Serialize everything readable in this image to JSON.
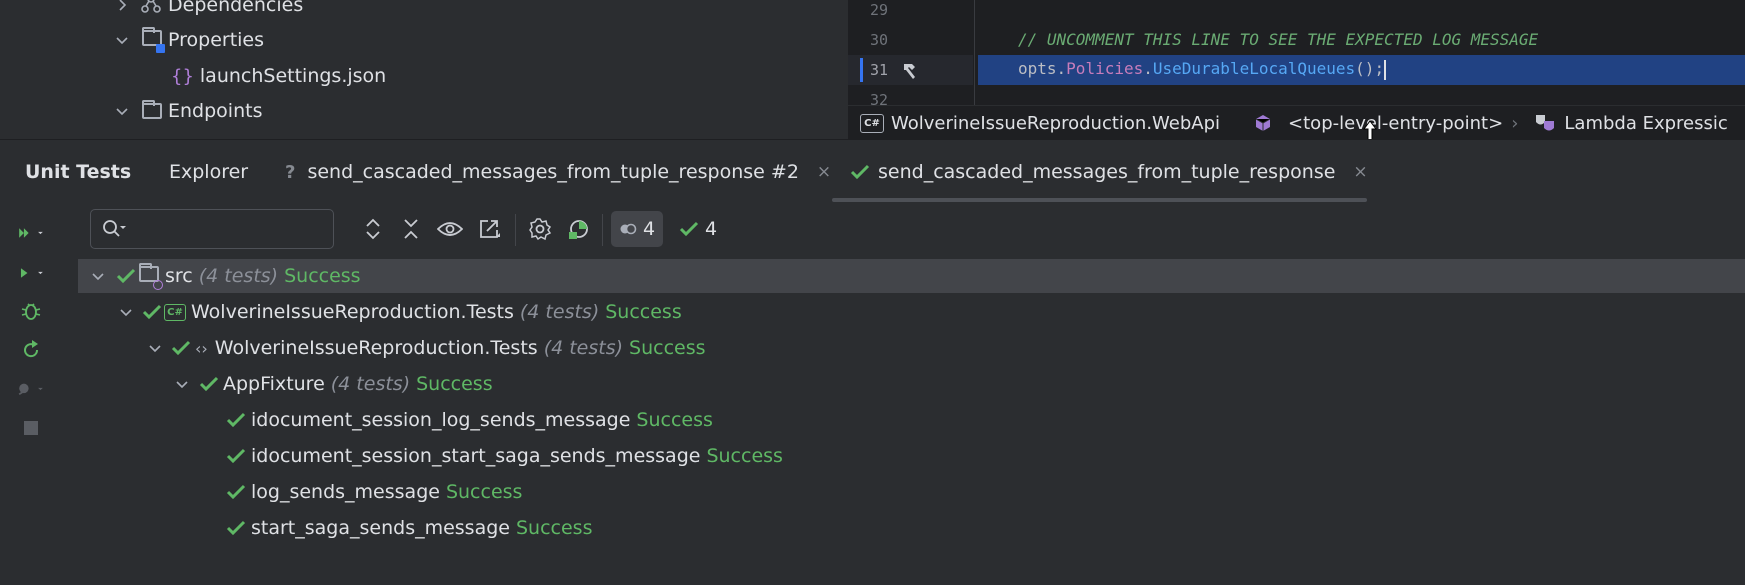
{
  "project_tree": {
    "items": [
      {
        "label": "Dependencies"
      },
      {
        "label": "Properties"
      },
      {
        "label": "launchSettings.json"
      },
      {
        "label": "Endpoints"
      }
    ]
  },
  "editor": {
    "line_numbers": [
      "29",
      "30",
      "31",
      "32"
    ],
    "comment_line": "// UNCOMMENT THIS LINE TO SEE THE EXPECTED LOG MESSAGE",
    "code_line": {
      "obj": "opts",
      "dot1": ".",
      "prop": "Policies",
      "dot2": ".",
      "method": "UseDurableLocalQueues",
      "tail": "();"
    },
    "breadcrumbs": {
      "project_badge": "C#",
      "project": "WolverineIssueReproduction.WebApi",
      "entry": "<top-level-entry-point>",
      "separator": "›",
      "lambda": "Lambda Expressic"
    }
  },
  "tool_window": {
    "title": "Unit Tests",
    "explorer_tab": "Explorer",
    "session_tab_1": "send_cascaded_messages_from_tuple_response #2",
    "session_tab_2": "send_cascaded_messages_from_tuple_response",
    "close_glyph": "×",
    "unknown_glyph": "?"
  },
  "toolbar": {
    "search_placeholder": "",
    "total_count": "4",
    "passed_count": "4"
  },
  "tests": {
    "root": {
      "label": "src",
      "count": "(4 tests)",
      "status": "Success"
    },
    "project": {
      "badge": "C#",
      "label": "WolverineIssueReproduction.Tests",
      "count": "(4 tests)",
      "status": "Success"
    },
    "namespace": {
      "label": "WolverineIssueReproduction.Tests",
      "count": "(4 tests)",
      "status": "Success",
      "glyph": "‹›"
    },
    "fixture": {
      "label": "AppFixture",
      "count": "(4 tests)",
      "status": "Success"
    },
    "cases": [
      {
        "label": "idocument_session_log_sends_message",
        "status": "Success"
      },
      {
        "label": "idocument_session_start_saga_sends_message",
        "status": "Success"
      },
      {
        "label": "log_sends_message",
        "status": "Success"
      },
      {
        "label": "start_saga_sends_message",
        "status": "Success"
      }
    ]
  },
  "colors": {
    "success": "#5fb865",
    "selection": "#214283",
    "comment": "#6aab73",
    "method": "#56a8f5"
  }
}
